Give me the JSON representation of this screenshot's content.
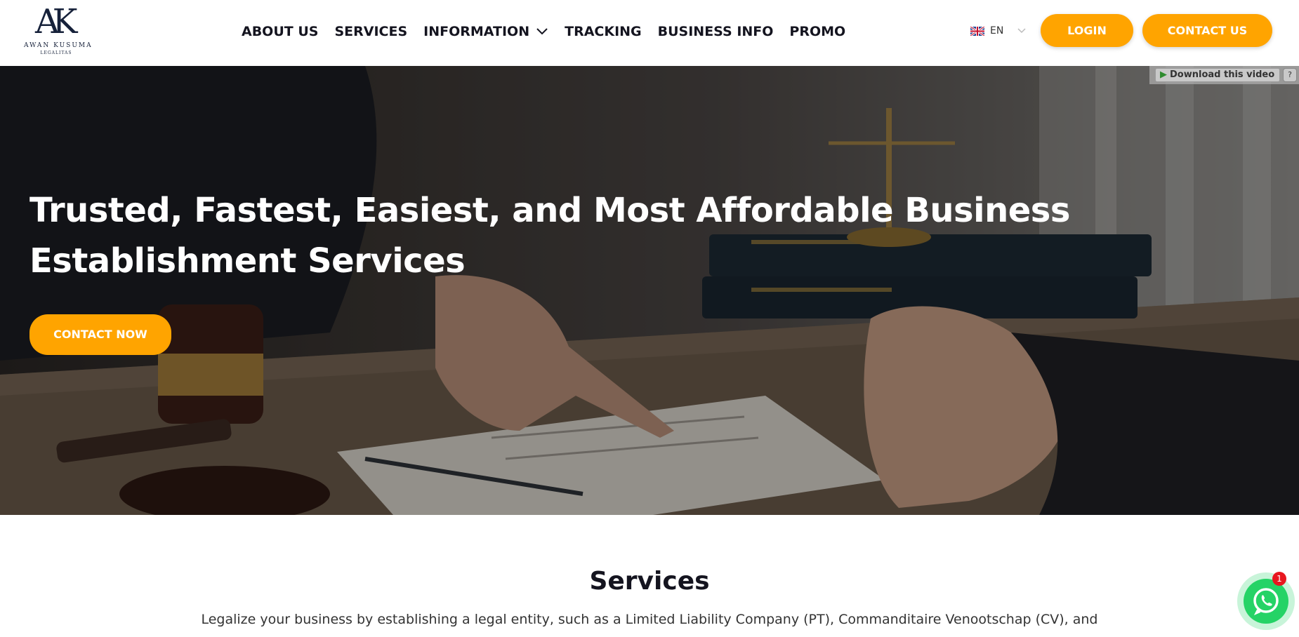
{
  "brand": {
    "logo_mark": "AK",
    "name": "AWAN KUSUMA",
    "sub": "LEGALITAS"
  },
  "nav": {
    "items": [
      {
        "label": "ABOUT US"
      },
      {
        "label": "SERVICES"
      },
      {
        "label": "INFORMATION"
      },
      {
        "label": "TRACKING"
      },
      {
        "label": "BUSINESS INFO"
      },
      {
        "label": "PROMO"
      }
    ]
  },
  "language": {
    "selected": "EN",
    "flag": "uk-flag-icon"
  },
  "header_buttons": {
    "login": "LOGIN",
    "contact": "CONTACT US"
  },
  "hero": {
    "title_line1": "Trusted, Fastest, Easiest, and Most Affordable Business",
    "title_line2": "Establishment Services",
    "cta": "CONTACT NOW",
    "download_label": "Download this video",
    "help_label": "?"
  },
  "services": {
    "title": "Services",
    "description": "Legalize your business by establishing a legal entity, such as a Limited Liability Company (PT), Commanditaire Venootschap (CV), and"
  },
  "whatsapp": {
    "badge": "1",
    "icon": "whatsapp-icon"
  },
  "colors": {
    "accent": "#ffa400",
    "whatsapp": "#25d366",
    "badge": "#e8171f"
  }
}
